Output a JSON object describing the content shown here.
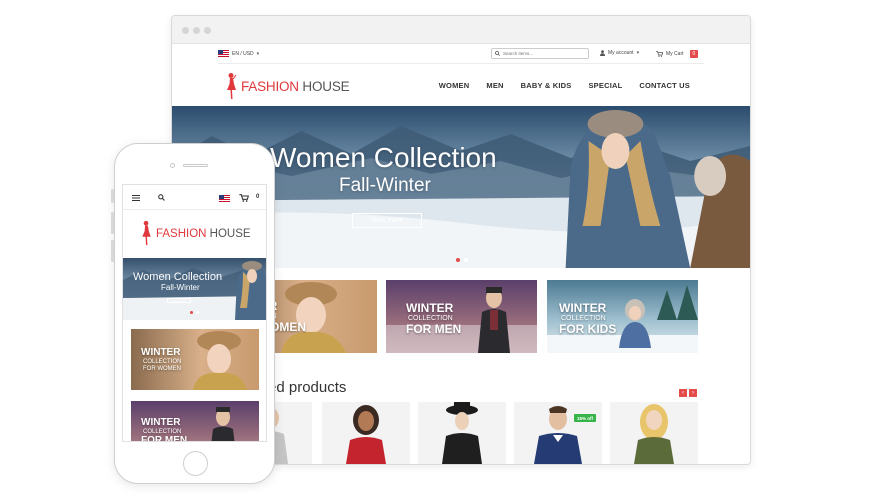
{
  "topbar": {
    "language": "EN / USD",
    "search_placeholder": "Search items...",
    "account_label": "My account",
    "cart_label": "My Cart",
    "cart_count": "0"
  },
  "brand": {
    "name_part1": "FASHION",
    "name_part2": " HOUSE",
    "accent_color": "#e0383c"
  },
  "nav": {
    "items": [
      "WOMEN",
      "MEN",
      "BABY & KIDS",
      "SPECIAL",
      "CONTACT US"
    ]
  },
  "hero": {
    "title": "Women Collection",
    "subtitle": "Fall-Winter",
    "button": "View more"
  },
  "banners": [
    {
      "line1": "WINTER",
      "line2": "COLLECTION",
      "line3": "FOR WOMEN"
    },
    {
      "line1": "WINTER",
      "line2": "COLLECTION",
      "line3": "FOR MEN"
    },
    {
      "line1": "WINTER",
      "line2": "COLLECTION",
      "line3": "FOR KIDS"
    }
  ],
  "featured": {
    "title": "ed products",
    "prev_arrow": "‹",
    "next_arrow": "›",
    "sale_badge": "15% off"
  },
  "mobile": {
    "cart_count": "0",
    "hero_title": "Women Collection",
    "hero_subtitle": "Fall-Winter",
    "hero_button": "View more"
  },
  "icons": {
    "menu": "hamburger-icon",
    "search": "search-icon",
    "cart": "cart-icon",
    "account": "user-icon",
    "flag": "us-flag-icon"
  }
}
